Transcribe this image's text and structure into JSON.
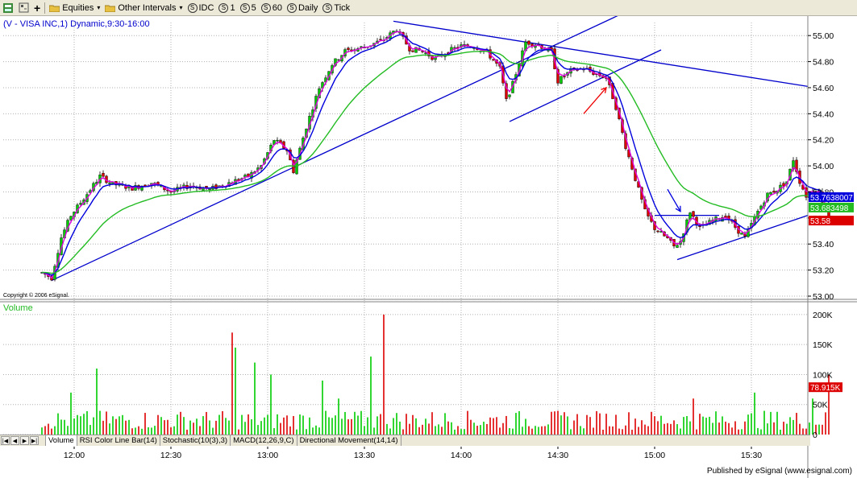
{
  "toolbar": {
    "equities_label": "Equities",
    "intervals_label": "Other Intervals",
    "buttons": [
      "IDC",
      "1",
      "5",
      "60",
      "Daily",
      "Tick"
    ]
  },
  "header": {
    "title": "(V - VISA INC,1) Dynamic,9:30-16:00",
    "copyright": "Copyright © 2006 eSignal."
  },
  "colors": {
    "up": "#00cc00",
    "down": "#dd0000",
    "ma_fast": "#dd00dd",
    "ma_mid": "#0000dd",
    "ma_slow": "#22bb22",
    "trendline": "#0000cc",
    "arrow_red": "#ee0000",
    "grid": "#b0b0b0"
  },
  "tabs": [
    "Volume",
    "RSI Color Line Bar(14)",
    "Stochastic(10(3),3)",
    "MACD(12,26,9,C)",
    "Directional Movement(14,14)"
  ],
  "footer": {
    "text": "Published by eSignal (www.esignal.com)"
  },
  "chart_data": {
    "type": "candlestick",
    "interval_minutes": 1,
    "session": "9:30-16:00",
    "price_panel": {
      "ylim": [
        53.0,
        55.1
      ],
      "ticks": [
        "55.00",
        "54.80",
        "54.60",
        "54.40",
        "54.20",
        "54.00",
        "53.80",
        "53.60",
        "53.40",
        "53.20",
        "53.00"
      ],
      "last_labels": [
        {
          "text": "53.7638007",
          "value": 53.76,
          "color": "#0000dd"
        },
        {
          "text": "53.683498",
          "value": 53.68,
          "color": "#22bb22"
        },
        {
          "text": "53.58",
          "value": 53.58,
          "color": "#dd0000"
        }
      ],
      "time_labels": [
        "12:00",
        "12:30",
        "13:00",
        "13:30",
        "14:00",
        "14:30",
        "15:00",
        "15:30"
      ],
      "time_anchor": "11:50",
      "time_end": "15:54",
      "path": [
        [
          "11:50",
          53.18
        ],
        [
          "11:53",
          53.14
        ],
        [
          "11:56",
          53.45
        ],
        [
          "11:59",
          53.62
        ],
        [
          "12:03",
          53.75
        ],
        [
          "12:08",
          53.92
        ],
        [
          "12:12",
          53.86
        ],
        [
          "12:18",
          53.83
        ],
        [
          "12:24",
          53.87
        ],
        [
          "12:30",
          53.8
        ],
        [
          "12:36",
          53.85
        ],
        [
          "12:42",
          53.82
        ],
        [
          "12:48",
          53.87
        ],
        [
          "12:54",
          53.92
        ],
        [
          "12:58",
          54.0
        ],
        [
          "13:02",
          54.2
        ],
        [
          "13:06",
          54.12
        ],
        [
          "13:08",
          53.96
        ],
        [
          "13:12",
          54.3
        ],
        [
          "13:16",
          54.6
        ],
        [
          "13:20",
          54.78
        ],
        [
          "13:24",
          54.88
        ],
        [
          "13:28",
          54.9
        ],
        [
          "13:32",
          54.93
        ],
        [
          "13:36",
          54.97
        ],
        [
          "13:40",
          55.05
        ],
        [
          "13:44",
          54.9
        ],
        [
          "13:48",
          54.88
        ],
        [
          "13:52",
          54.82
        ],
        [
          "13:56",
          54.88
        ],
        [
          "14:00",
          54.92
        ],
        [
          "14:04",
          54.92
        ],
        [
          "14:08",
          54.87
        ],
        [
          "14:12",
          54.75
        ],
        [
          "14:14",
          54.5
        ],
        [
          "14:16",
          54.63
        ],
        [
          "14:20",
          54.95
        ],
        [
          "14:24",
          54.93
        ],
        [
          "14:28",
          54.87
        ],
        [
          "14:30",
          54.65
        ],
        [
          "14:34",
          54.73
        ],
        [
          "14:38",
          54.75
        ],
        [
          "14:42",
          54.7
        ],
        [
          "14:45",
          54.68
        ],
        [
          "14:48",
          54.45
        ],
        [
          "14:51",
          54.15
        ],
        [
          "14:54",
          53.9
        ],
        [
          "14:57",
          53.65
        ],
        [
          "15:00",
          53.52
        ],
        [
          "15:04",
          53.44
        ],
        [
          "15:06",
          53.38
        ],
        [
          "15:08",
          53.42
        ],
        [
          "15:11",
          53.65
        ],
        [
          "15:14",
          53.52
        ],
        [
          "15:18",
          53.58
        ],
        [
          "15:22",
          53.62
        ],
        [
          "15:26",
          53.5
        ],
        [
          "15:28",
          53.45
        ],
        [
          "15:32",
          53.65
        ],
        [
          "15:35",
          53.78
        ],
        [
          "15:38",
          53.82
        ],
        [
          "15:41",
          53.88
        ],
        [
          "15:43",
          54.05
        ],
        [
          "15:45",
          53.88
        ],
        [
          "15:47",
          53.77
        ],
        [
          "15:49",
          53.82
        ],
        [
          "15:51",
          53.8
        ],
        [
          "15:54",
          53.6
        ]
      ],
      "lines": [
        {
          "name": "ma_fast",
          "lag": 0.55
        },
        {
          "name": "ma_mid",
          "lag": 0.25
        },
        {
          "name": "ma_slow",
          "lag": 0.07
        }
      ],
      "trendlines": [
        {
          "from": [
            "11:53",
            53.12
          ],
          "to": [
            "15:03",
            55.32
          ]
        },
        {
          "from": [
            "13:39",
            55.11
          ],
          "to": [
            "15:56",
            54.61
          ]
        },
        {
          "from": [
            "14:15",
            54.34
          ],
          "to": [
            "15:02",
            54.89
          ]
        },
        {
          "from": [
            "15:07",
            53.28
          ],
          "to": [
            "15:56",
            53.62
          ]
        },
        {
          "from": [
            "15:00",
            53.62
          ],
          "to": [
            "15:20",
            53.62
          ]
        }
      ],
      "arrows": [
        {
          "color": "#0000dd",
          "tail": [
            "15:04",
            53.82
          ],
          "head": [
            "15:08",
            53.65
          ]
        },
        {
          "color": "#ee0000",
          "tail": [
            "14:38",
            54.4
          ],
          "head": [
            "14:45",
            54.6
          ]
        }
      ]
    },
    "volume_panel": {
      "label": "Volume",
      "ylim": [
        0,
        220000
      ],
      "ticks": [
        "200K",
        "150K",
        "100K",
        "50K",
        "0"
      ],
      "last_label": {
        "text": "78.915K",
        "value": 78915
      },
      "typical_range": [
        8000,
        40000
      ],
      "spikes": [
        [
          "12:07",
          110000
        ],
        [
          "11:59",
          70000
        ],
        [
          "12:49",
          170000
        ],
        [
          "12:50",
          145000
        ],
        [
          "12:56",
          120000
        ],
        [
          "13:01",
          100000
        ],
        [
          "13:17",
          90000
        ],
        [
          "13:22",
          60000
        ],
        [
          "13:36",
          200000
        ],
        [
          "13:32",
          130000
        ],
        [
          "15:54",
          100000
        ],
        [
          "15:49",
          60000
        ],
        [
          "15:31",
          70000
        ],
        [
          "15:12",
          60000
        ]
      ]
    }
  }
}
